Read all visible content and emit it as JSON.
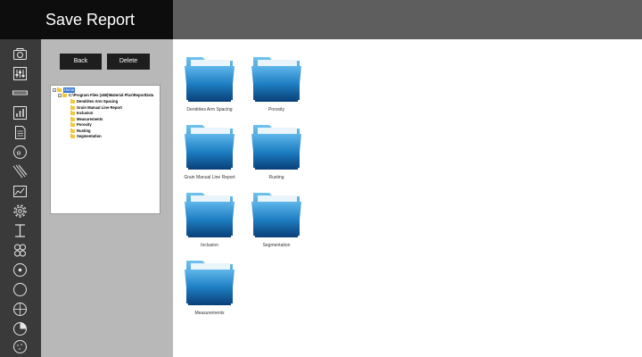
{
  "window": {
    "title": "Save Report"
  },
  "sidebar": {
    "items": [
      {
        "icon": "camera-icon"
      },
      {
        "icon": "sliders-icon"
      },
      {
        "icon": "measure-bar-icon"
      },
      {
        "icon": "bar-chart-icon"
      },
      {
        "icon": "document-icon"
      },
      {
        "icon": "grain-icon"
      },
      {
        "icon": "hatching-icon"
      },
      {
        "icon": "line-chart-icon"
      },
      {
        "icon": "gear-icon"
      },
      {
        "icon": "i-beam-icon"
      },
      {
        "icon": "particles-icon"
      },
      {
        "icon": "circle-dot-icon"
      },
      {
        "icon": "circle-icon"
      },
      {
        "icon": "crosshair-icon"
      },
      {
        "icon": "pie-icon"
      },
      {
        "icon": "dotted-circle-icon"
      }
    ]
  },
  "panel": {
    "back_label": "Back",
    "delete_label": "Delete",
    "tree": {
      "root": "Home",
      "path": "C:\\Program Files (x86)\\Material Plus\\ReportData",
      "children": [
        "Dendrites Arm Spacing",
        "Grain Manual Line Report",
        "Inclusion",
        "Measurements",
        "Porosity",
        "Rusting",
        "Segmentation"
      ]
    }
  },
  "main": {
    "folders": [
      {
        "label": "Dendrites Arm Spacing"
      },
      {
        "label": "Porosity"
      },
      {
        "label": "Grain Manual Line Report"
      },
      {
        "label": "Rusting"
      },
      {
        "label": "Inclusion"
      },
      {
        "label": "Segmentation"
      },
      {
        "label": "Measurements"
      }
    ]
  },
  "colors": {
    "titlebar": "#0d0d0d",
    "topbar": "#5e5e5e",
    "sidebar": "#3a3a3a",
    "panel": "#b8b8b8",
    "folder_blue": "#1d7fc0",
    "tree_folder": "#f2c73c"
  }
}
